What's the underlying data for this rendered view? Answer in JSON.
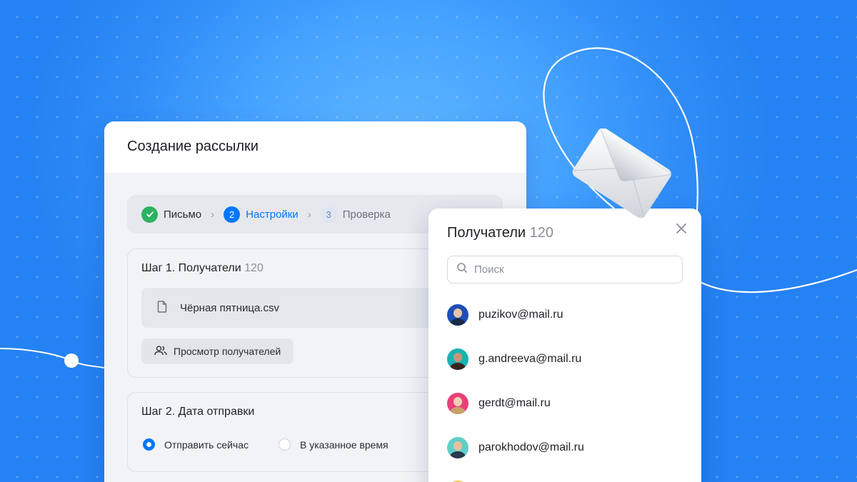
{
  "main": {
    "title": "Создание рассылки",
    "steps": [
      {
        "num": "✓",
        "label": "Письмо",
        "state": "done"
      },
      {
        "num": "2",
        "label": "Настройки",
        "state": "active"
      },
      {
        "num": "3",
        "label": "Проверка",
        "state": "todo"
      }
    ],
    "step1": {
      "title": "Шаг 1. Получатели",
      "count": "120",
      "file_name": "Чёрная пятница.csv",
      "view_button": "Просмотр получателей"
    },
    "step2": {
      "title": "Шаг 2. Дата отправки",
      "options": [
        {
          "label": "Отправить сейчас",
          "checked": true
        },
        {
          "label": "В указанное время",
          "checked": false
        }
      ]
    }
  },
  "popup": {
    "title": "Получатели",
    "count": "120",
    "search_placeholder": "Поиск",
    "recipients": [
      {
        "email": "puzikov@mail.ru",
        "avatar_color": "#1e4fb8"
      },
      {
        "email": "g.andreeva@mail.ru",
        "avatar_color": "#19b3b0"
      },
      {
        "email": "gerdt@mail.ru",
        "avatar_color": "#e8407a"
      },
      {
        "email": "parokhodov@mail.ru",
        "avatar_color": "#5fd0c8"
      }
    ]
  },
  "colors": {
    "accent": "#0077ff",
    "success": "#2bb361",
    "background": "#3396f9"
  },
  "icons": [
    "check-icon",
    "chevron-right-icon",
    "file-icon",
    "users-icon",
    "search-icon",
    "close-icon",
    "envelope-icon"
  ]
}
